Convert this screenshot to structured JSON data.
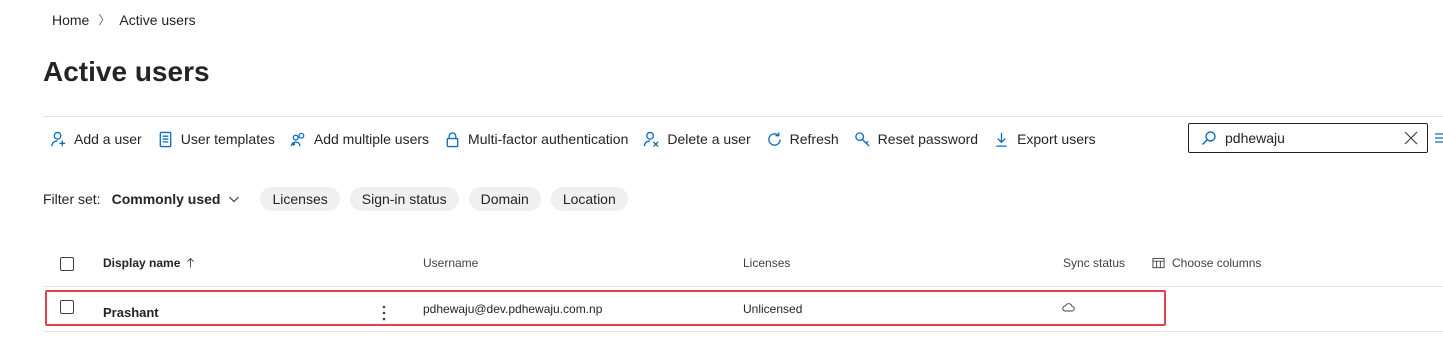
{
  "breadcrumb": {
    "home": "Home",
    "current": "Active users"
  },
  "page": {
    "title": "Active users"
  },
  "toolbar": {
    "items": [
      {
        "label": "Add a user",
        "icon": "add-user-icon"
      },
      {
        "label": "User templates",
        "icon": "document-icon"
      },
      {
        "label": "Add multiple users",
        "icon": "add-people-icon"
      },
      {
        "label": "Multi-factor authentication",
        "icon": "lock-icon"
      },
      {
        "label": "Delete a user",
        "icon": "delete-user-icon"
      },
      {
        "label": "Refresh",
        "icon": "refresh-icon"
      },
      {
        "label": "Reset password",
        "icon": "key-icon"
      },
      {
        "label": "Export users",
        "icon": "download-icon"
      }
    ]
  },
  "search": {
    "value": "pdhewaju",
    "icon": "search-icon"
  },
  "filter": {
    "label": "Filter set:",
    "value": "Commonly used",
    "pills": [
      "Licenses",
      "Sign-in status",
      "Domain",
      "Location"
    ]
  },
  "table": {
    "columns": {
      "display_name": "Display name",
      "username": "Username",
      "licenses": "Licenses",
      "sync_status": "Sync status",
      "choose_columns": "Choose columns"
    },
    "rows": [
      {
        "display_name": "Prashant",
        "username": "pdhewaju@dev.pdhewaju.com.np",
        "licenses": "Unlicensed",
        "sync_status_icon": "cloud-icon"
      }
    ]
  },
  "colors": {
    "accent": "#0f6cbd",
    "highlight": "#e0434f"
  }
}
